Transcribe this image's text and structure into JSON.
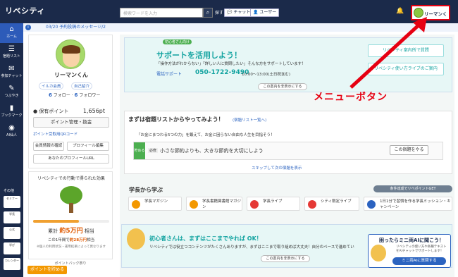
{
  "header": {
    "logo": "リベシティ",
    "search_placeholder": "検索ワードを入力",
    "search_suffix": "探す",
    "chat_label": "チャット",
    "user_label": "ユーザー",
    "user_name": "リーマンくん"
  },
  "leftnav": [
    {
      "label": "ホーム",
      "icon": "home-icon"
    },
    {
      "label": "宿題リスト",
      "icon": "list-icon"
    },
    {
      "label": "参加チャット",
      "icon": "chat-icon"
    },
    {
      "label": "つぶやき",
      "icon": "tweet-icon"
    },
    {
      "label": "ブックマーク",
      "icon": "bookmark-icon"
    },
    {
      "label": "AI仙人",
      "icon": "ai-icon"
    }
  ],
  "leftnav_other": "その他",
  "sidethumbs": [
    "セミナー",
    "学長",
    "公式",
    "学び",
    "カレンダー"
  ],
  "notice": "03/20 予約投稿のメッセージ/2",
  "profile": {
    "name": "リーマンくん",
    "badge1": "イルカ会員",
    "badge2": "自己紹介",
    "follow_count": "6",
    "follow_label": "フォロー",
    "follower_count": "6",
    "follower_label": "フォロワー",
    "points_label": "保有ポイント",
    "points_value": "1,656pt",
    "points_button": "ポイント管理・換金",
    "points_link": "ポイント受取用QRコード",
    "member_btn": "会員情報の確認",
    "edit_btn": "プロフィール編集",
    "url_btn": "あなたのプロフィールURL"
  },
  "effect": {
    "title": "リベシティでの行動で得られた効果",
    "progress": 0.6,
    "total_label": "累計",
    "total_value": "約5万円",
    "total_suffix": "相当",
    "year_prefix": "この1年間で",
    "year_value": "約28万円",
    "year_suffix": "相当",
    "note": "※個人の利用状況・運用結果によって異なります"
  },
  "pointback": {
    "heading": "ポイントバック祭り",
    "get": "ポイントを貯める"
  },
  "support": {
    "beginner_tag": "初心者さん向け",
    "title": "サポートを活用しよう！",
    "subtitle": "「操作方法がわからない」「詳しい人に質問したい」そんな方をサポートしています！",
    "tel_label": "電話サポート",
    "tel": "050-1722-9490",
    "hours": "10:00〜13:00(土日祝含む)",
    "close": "この案内を非表示にする",
    "btn1": "リベシティ案内所で質問",
    "btn2": "リベシティ使い方ライブのご案内"
  },
  "annotation": "メニューボタン",
  "tasks": {
    "title": "まずは宿題リストからやってみよう！",
    "link": "(宿題リスト一覧へ)",
    "question": "「お金にまつわる5つの力」を鍛えて、お金に困らない自由な人生を目指そう！",
    "tag": "貯める",
    "required": "必修",
    "text": "小さな節約よりも、大きな節約を大切にしよう",
    "button": "この宿題をやる",
    "skip": "スキップして次の宿題を表示"
  },
  "learn": {
    "title": "学長から学ぶ",
    "badge": "条件達成でリベポイントGET",
    "items": [
      {
        "label": "学長マガジン",
        "color": "#f39800"
      },
      {
        "label": "学長書籍図書館マガジン",
        "color": "#f39800"
      },
      {
        "label": "学長ライブ",
        "color": "#e53935"
      },
      {
        "label": "シティ限定ライブ",
        "color": "#e53935"
      },
      {
        "label": "1日1分で習慣を作る学長ミッション・キャンペーン",
        "color": "#2b63c0"
      }
    ]
  },
  "beginner2": {
    "title": "初心者さんは、まずはここまでやれば OK！",
    "sub": "リベシティでは役立つコンテンツがたくさんありますが、まずはここまで取り組めば大丈夫！自分のペースで進めてい",
    "close": "この案内を非表示にする"
  },
  "chat": {
    "title": "困ったらミニ両AIに聞こう！",
    "sub": "リベシティの使い方や各種テキストをAIチャットでサポートします！",
    "button": "ミニ両AIに質問する"
  }
}
